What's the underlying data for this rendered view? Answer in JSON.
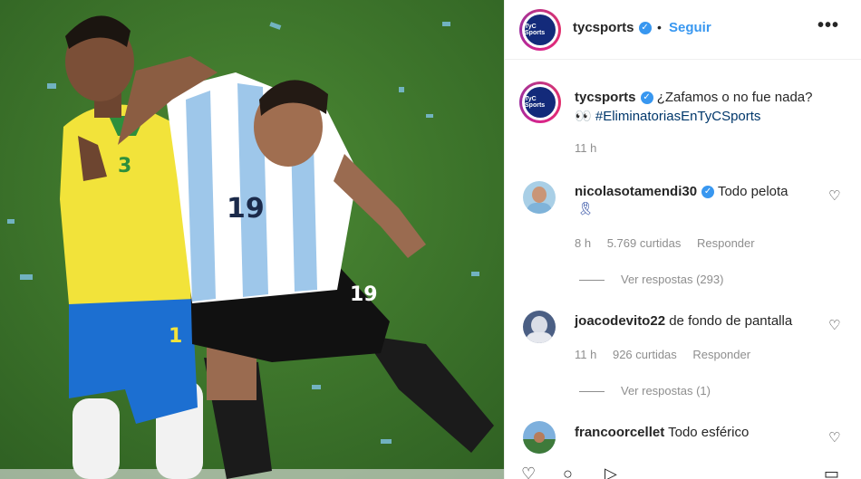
{
  "header": {
    "username": "tycsports",
    "separator": "•",
    "follow_label": "Seguir",
    "more_icon": "more-horizontal-icon",
    "avatar_text": "TyC Sports"
  },
  "caption": {
    "username": "tycsports",
    "text": "¿Zafamos o no fue nada?",
    "emoji": "👀",
    "hashtag": "#EliminatoriasEnTyCSports",
    "time": "11 h"
  },
  "comments": [
    {
      "username": "nicolasotamendi30",
      "verified": true,
      "text": "Todo pelota",
      "emoji": "🎗",
      "time": "8 h",
      "likes": "5.769 curtidas",
      "reply_label": "Responder",
      "view_replies": "Ver respostas (293)"
    },
    {
      "username": "joacodevito22",
      "verified": false,
      "text": "de fondo de pantalla",
      "time": "11 h",
      "likes": "926 curtidas",
      "reply_label": "Responder",
      "view_replies": "Ver respostas (1)"
    },
    {
      "username": "francoorcellet",
      "verified": false,
      "text": "Todo esférico"
    }
  ],
  "photo": {
    "jersey_number_left": "19",
    "jersey_number_right": "19",
    "yellow_number": "3",
    "short_number": "1"
  },
  "colors": {
    "link_blue": "#3897f0",
    "hashtag_blue": "#00376b",
    "meta_gray": "#8e8e8e",
    "pitch_green": "#3f7a2c",
    "brazil_yellow": "#f2e33a",
    "brazil_blue": "#1c6fd1",
    "argentina_skyblue": "#9ec7ea"
  }
}
